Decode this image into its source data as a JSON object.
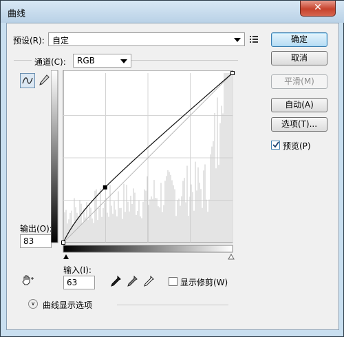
{
  "window": {
    "title": "曲线",
    "close_glyph": "✕"
  },
  "preset": {
    "label": "预设(R):",
    "value": "自定"
  },
  "channel": {
    "label": "通道(C):",
    "value": "RGB"
  },
  "output": {
    "label": "输出(O):",
    "value": "83"
  },
  "input": {
    "label": "输入(I):",
    "value": "63"
  },
  "buttons": {
    "ok": "确定",
    "cancel": "取消",
    "smooth": "平滑(M)",
    "auto": "自动(A)",
    "options": "选项(T)..."
  },
  "preview": {
    "label": "预览(P)",
    "checked": true
  },
  "show_clipping": {
    "label": "显示修剪(W)",
    "checked": false
  },
  "curve_display_options": {
    "label": "曲线显示选项"
  },
  "curve": {
    "point": {
      "input": 63,
      "output": 83
    },
    "start": {
      "input": 0,
      "output": 0
    },
    "end": {
      "input": 255,
      "output": 255
    }
  },
  "icons": [
    "list-menu-icon",
    "curve-tool-icon",
    "pencil-tool-icon",
    "hand-adjust-icon",
    "black-eyedropper-icon",
    "gray-eyedropper-icon",
    "white-eyedropper-icon",
    "expand-chevron-icon"
  ]
}
